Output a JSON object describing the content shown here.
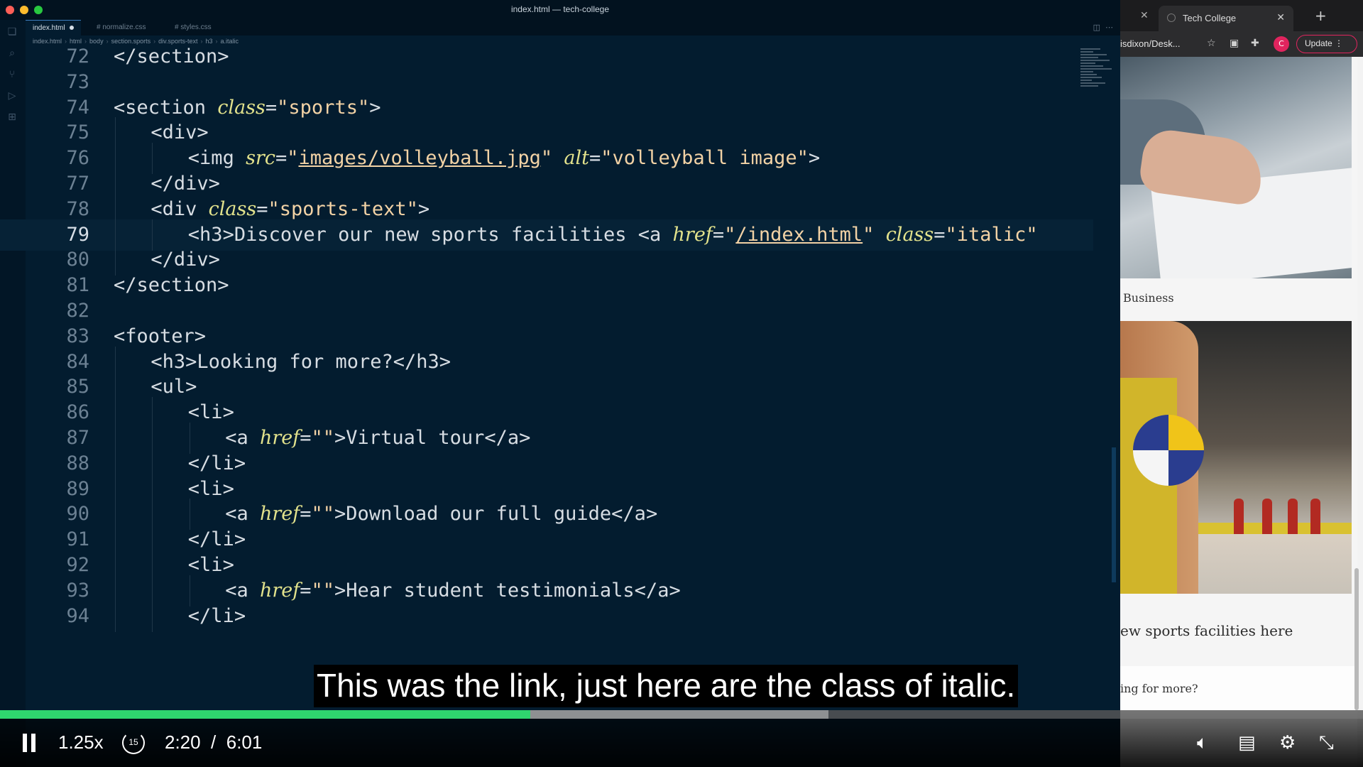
{
  "editor": {
    "window_title": "index.html — tech-college",
    "tabs": [
      {
        "label": "index.html",
        "active": true
      },
      {
        "label": "# normalize.css",
        "active": false
      },
      {
        "label": "# styles.css",
        "active": false
      }
    ],
    "breadcrumb": [
      "index.html",
      "html",
      "body",
      "section.sports",
      "div.sports-text",
      "h3",
      "a.italic"
    ],
    "current_line": "79",
    "lines": [
      {
        "n": "72",
        "indent": 1,
        "text": "</section>"
      },
      {
        "n": "73",
        "indent": 0,
        "text": ""
      },
      {
        "n": "74",
        "indent": 1,
        "text": "<section class=\"sports\">"
      },
      {
        "n": "75",
        "indent": 2,
        "text": "<div>"
      },
      {
        "n": "76",
        "indent": 3,
        "text": "<img src=\"images/volleyball.jpg\" alt=\"volleyball image\">"
      },
      {
        "n": "77",
        "indent": 2,
        "text": "</div>"
      },
      {
        "n": "78",
        "indent": 2,
        "text": "<div class=\"sports-text\">"
      },
      {
        "n": "79",
        "indent": 3,
        "text": "<h3>Discover our new sports facilities <a href=\"/index.html\" class=\"italic\""
      },
      {
        "n": "80",
        "indent": 2,
        "text": "</div>"
      },
      {
        "n": "81",
        "indent": 1,
        "text": "</section>"
      },
      {
        "n": "82",
        "indent": 0,
        "text": ""
      },
      {
        "n": "83",
        "indent": 1,
        "text": "<footer>"
      },
      {
        "n": "84",
        "indent": 2,
        "text": "<h3>Looking for more?</h3>"
      },
      {
        "n": "85",
        "indent": 2,
        "text": "<ul>"
      },
      {
        "n": "86",
        "indent": 3,
        "text": "<li>"
      },
      {
        "n": "87",
        "indent": 4,
        "text": "<a href=\"\">Virtual tour</a>"
      },
      {
        "n": "88",
        "indent": 3,
        "text": "</li>"
      },
      {
        "n": "89",
        "indent": 3,
        "text": "<li>"
      },
      {
        "n": "90",
        "indent": 4,
        "text": "<a href=\"\">Download our full guide</a>"
      },
      {
        "n": "91",
        "indent": 3,
        "text": "</li>"
      },
      {
        "n": "92",
        "indent": 3,
        "text": "<li>"
      },
      {
        "n": "93",
        "indent": 4,
        "text": "<a href=\"\">Hear student testimonials</a>"
      },
      {
        "n": "94",
        "indent": 3,
        "text": "</li>"
      }
    ]
  },
  "browser": {
    "tab_title": "Tech College",
    "url": "isdixon/Desk...",
    "profile_initial": "C",
    "update_label": "Update",
    "business_caption": "Business",
    "sports_caption": "ew sports facilities here",
    "footer_heading": "ing for more?"
  },
  "player": {
    "speed": "1.25x",
    "rewind_label": "15",
    "current_time": "2:20",
    "duration": "6:01",
    "played_fraction": 0.389,
    "buffered_fraction": 0.608,
    "subtitle": "This was the link, just here are the class of italic."
  },
  "colors": {
    "accent_progress": "#2fd66e",
    "editor_bg": "#031c2f",
    "attribute": "#e2e28c",
    "string": "#f2d2a5"
  }
}
